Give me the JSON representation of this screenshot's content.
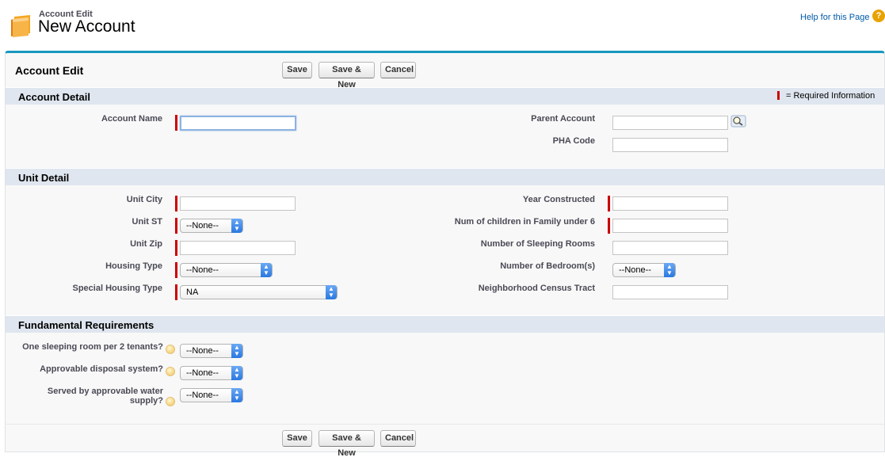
{
  "header": {
    "subtitle": "Account Edit",
    "title": "New Account",
    "help_link": "Help for this Page",
    "help_icon": "?"
  },
  "block": {
    "title": "Account Edit",
    "buttons": {
      "save": "Save",
      "save_new": "Save & New",
      "cancel": "Cancel"
    },
    "required_legend": "= Required Information"
  },
  "sections": {
    "account_detail": {
      "title": "Account Detail",
      "account_name_label": "Account Name",
      "account_name_value": "",
      "parent_account_label": "Parent Account",
      "parent_account_value": "",
      "pha_code_label": "PHA Code",
      "pha_code_value": ""
    },
    "unit_detail": {
      "title": "Unit Detail",
      "unit_city_label": "Unit City",
      "unit_city_value": "",
      "unit_st_label": "Unit ST",
      "unit_st_value": "--None--",
      "unit_zip_label": "Unit Zip",
      "unit_zip_value": "",
      "housing_type_label": "Housing Type",
      "housing_type_value": "--None--",
      "special_housing_label": "Special Housing Type",
      "special_housing_value": "NA",
      "year_constructed_label": "Year Constructed",
      "year_constructed_value": "",
      "children_label": "Num of children in Family under 6",
      "children_value": "",
      "sleeping_rooms_label": "Number of Sleeping Rooms",
      "sleeping_rooms_value": "",
      "bedrooms_label": "Number of Bedroom(s)",
      "bedrooms_value": "--None--",
      "census_label": "Neighborhood Census Tract",
      "census_value": ""
    },
    "fundamental": {
      "title": "Fundamental Requirements",
      "q1_label": "One sleeping room per 2 tenants?",
      "q1_value": "--None--",
      "q2_label": "Approvable disposal system?",
      "q2_value": "--None--",
      "q3_label_line1": "Served by approvable water",
      "q3_label_line2": "supply?",
      "q3_value": "--None--"
    }
  },
  "colors": {
    "accent": "#1797c0",
    "required": "#cc0000",
    "section_bg": "#dfe6ef",
    "link": "#015ba7"
  },
  "icons": {
    "folder": "folder-icon",
    "help": "help-icon",
    "lookup": "lookup-magnifier-icon",
    "hint": "info-hint-icon",
    "select_arrows": "updown-arrows-icon"
  }
}
